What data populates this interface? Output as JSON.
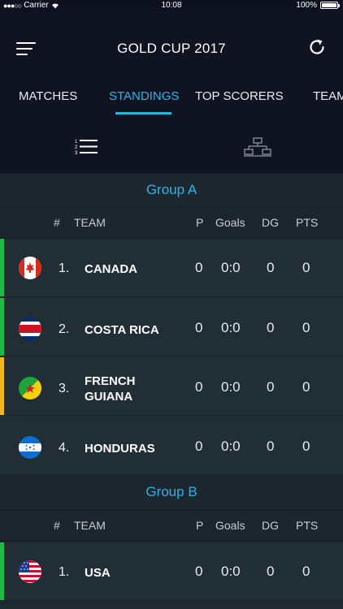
{
  "status_bar": {
    "signal": "●●●○○",
    "carrier": "Carrier",
    "time": "10:08",
    "battery": "100%"
  },
  "header": {
    "title": "GOLD CUP 2017"
  },
  "tabs": [
    {
      "label": "MATCHES",
      "active": false
    },
    {
      "label": "STANDINGS",
      "active": true
    },
    {
      "label": "TOP SCORERS",
      "active": false
    },
    {
      "label": "TEAM",
      "active": false
    }
  ],
  "colors": {
    "accent": "#2bb4e8",
    "qualified": "#1fb84a",
    "third_place": "#f2b71c"
  },
  "columns": {
    "pos": "#",
    "team": "TEAM",
    "played": "P",
    "goals": "Goals",
    "goal_diff": "DG",
    "points": "PTS"
  },
  "groups": [
    {
      "name": "Group A",
      "teams": [
        {
          "pos": "1.",
          "name": "CANADA",
          "flag": "canada-flag",
          "status": "qualified",
          "p": "0",
          "goals": "0:0",
          "dg": "0",
          "pts": "0"
        },
        {
          "pos": "2.",
          "name": "COSTA RICA",
          "flag": "costa-rica-flag",
          "status": "qualified",
          "p": "0",
          "goals": "0:0",
          "dg": "0",
          "pts": "0"
        },
        {
          "pos": "3.",
          "name": "FRENCH GUIANA",
          "flag": "french-guiana-flag",
          "status": "third_place",
          "p": "0",
          "goals": "0:0",
          "dg": "0",
          "pts": "0"
        },
        {
          "pos": "4.",
          "name": "HONDURAS",
          "flag": "honduras-flag",
          "status": "none",
          "p": "0",
          "goals": "0:0",
          "dg": "0",
          "pts": "0"
        }
      ]
    },
    {
      "name": "Group B",
      "teams": [
        {
          "pos": "1.",
          "name": "USA",
          "flag": "usa-flag",
          "status": "qualified",
          "p": "0",
          "goals": "0:0",
          "dg": "0",
          "pts": "0"
        }
      ]
    }
  ]
}
